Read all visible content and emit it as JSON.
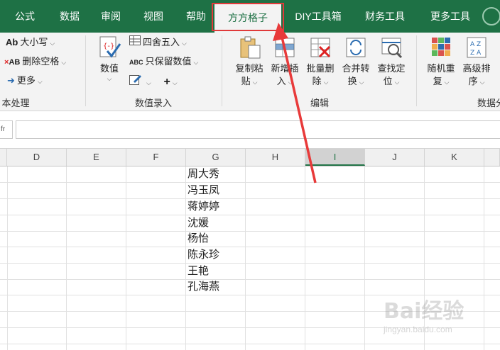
{
  "tabs": [
    "公式",
    "数据",
    "审阅",
    "视图",
    "帮助",
    "方方格子",
    "DIY工具箱",
    "财务工具",
    "更多工具"
  ],
  "active_tab": "方方格子",
  "ribbon": {
    "text_group": {
      "label": "本处理",
      "items": [
        "大小写",
        "删除空格",
        "更多"
      ],
      "icons": [
        "Ab",
        "AB"
      ]
    },
    "value_group": {
      "label": "数值录入",
      "big_button": "数值",
      "items": [
        "四舍五入",
        "只保留数值"
      ],
      "icon_text": "ABC"
    },
    "edit_group": {
      "label": "编辑",
      "buttons": [
        {
          "line1": "复制粘",
          "line2": "贴"
        },
        {
          "line1": "新增插",
          "line2": "入"
        },
        {
          "line1": "批量删",
          "line2": "除"
        },
        {
          "line1": "合并转",
          "line2": "换"
        },
        {
          "line1": "查找定",
          "line2": "位"
        }
      ]
    },
    "data_group": {
      "label": "数据分",
      "buttons": [
        {
          "line1": "随机重",
          "line2": "复"
        },
        {
          "line1": "高级排",
          "line2": "序"
        }
      ]
    }
  },
  "namebox_fragment": "fr",
  "columns": [
    "D",
    "E",
    "F",
    "G",
    "H",
    "I",
    "J",
    "K"
  ],
  "selected_column": "I",
  "cells_g": [
    "周大秀",
    "冯玉凤",
    "蒋婷婷",
    "沈媛",
    "杨怡",
    "陈永珍",
    "王艳",
    "孔海燕"
  ],
  "watermark": {
    "logo": "Bai经验",
    "sub": "jingyan.baidu.com"
  },
  "colors": {
    "ribbon_green": "#1e7145",
    "highlight_red": "#e03a3a"
  }
}
